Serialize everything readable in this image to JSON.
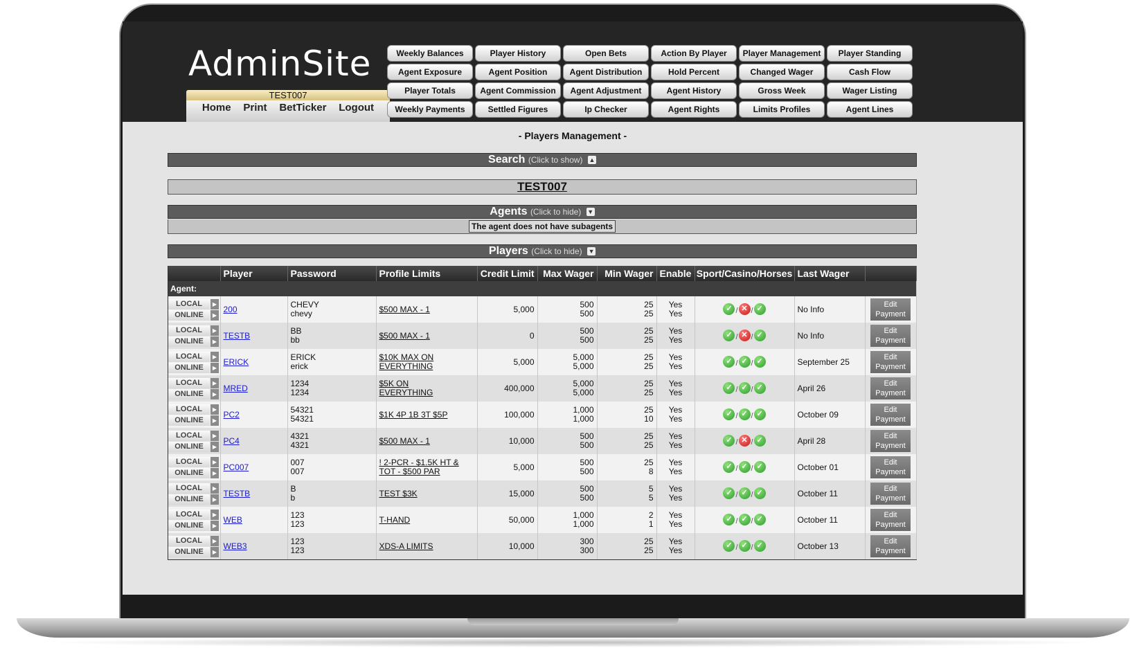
{
  "app": {
    "logo_text": "AdminSite",
    "username": "TEST007",
    "user_links": [
      "Home",
      "Print",
      "BetTicker",
      "Logout"
    ]
  },
  "nav": [
    "Weekly Balances",
    "Player History",
    "Open Bets",
    "Action By Player",
    "Player Management",
    "Player Standing",
    "Agent Exposure",
    "Agent Position",
    "Agent Distribution",
    "Hold Percent",
    "Changed Wager",
    "Cash Flow",
    "Player Totals",
    "Agent Commission",
    "Agent Adjustment",
    "Agent History",
    "Gross Week",
    "Wager Listing",
    "Weekly Payments",
    "Settled Figures",
    "Ip Checker",
    "Agent Rights",
    "Limits Profiles",
    "Agent Lines"
  ],
  "page": {
    "title": "- Players Management -",
    "search": {
      "label": "Search",
      "hint": "(Click to show)",
      "icon": "expand-up-icon"
    },
    "agent_name": "TEST007",
    "agents": {
      "label": "Agents",
      "hint": "(Click to hide)",
      "message": "The agent does not have subagents",
      "icon": "collapse-down-icon"
    },
    "players": {
      "label": "Players",
      "hint": "(Click to hide)",
      "icon": "collapse-down-icon"
    }
  },
  "table": {
    "columns": [
      "",
      "Player",
      "Password",
      "Profile Limits",
      "Credit Limit",
      "Max Wager",
      "Min Wager",
      "Enable",
      "Sport/Casino/Horses",
      "Last Wager",
      ""
    ],
    "agent_label": "Agent:",
    "local_label": "LOCAL",
    "online_label": "ONLINE",
    "edit_label": "Edit",
    "payment_label": "Payment",
    "rows": [
      {
        "player": "200",
        "pw1": "CHEVY",
        "pw2": "chevy",
        "profile1": "$500 MAX - 1",
        "profile2": "",
        "credit": "5,000",
        "max1": "500",
        "max2": "500",
        "min1": "25",
        "min2": "25",
        "en1": "Yes",
        "en2": "Yes",
        "status": [
          "ok",
          "no",
          "ok"
        ],
        "last": "No Info"
      },
      {
        "player": "TESTB",
        "pw1": "BB",
        "pw2": "bb",
        "profile1": "$500 MAX - 1",
        "profile2": "",
        "credit": "0",
        "max1": "500",
        "max2": "500",
        "min1": "25",
        "min2": "25",
        "en1": "Yes",
        "en2": "Yes",
        "status": [
          "ok",
          "no",
          "ok"
        ],
        "last": "No Info"
      },
      {
        "player": "ERICK",
        "pw1": "ERICK",
        "pw2": "erick",
        "profile1": "$10K MAX ON",
        "profile2": "EVERYTHING",
        "credit": "5,000",
        "max1": "5,000",
        "max2": "5,000",
        "min1": "25",
        "min2": "25",
        "en1": "Yes",
        "en2": "Yes",
        "status": [
          "ok",
          "ok",
          "ok"
        ],
        "last": "September 25"
      },
      {
        "player": "MRED",
        "pw1": "1234",
        "pw2": "1234",
        "profile1": "$5K ON",
        "profile2": "EVERYTHING",
        "credit": "400,000",
        "max1": "5,000",
        "max2": "5,000",
        "min1": "25",
        "min2": "25",
        "en1": "Yes",
        "en2": "Yes",
        "status": [
          "ok",
          "ok",
          "ok"
        ],
        "last": "April 26"
      },
      {
        "player": "PC2",
        "pw1": "54321",
        "pw2": "54321",
        "profile1": "$1K 4P 1B 3T $5P",
        "profile2": "",
        "credit": "100,000",
        "max1": "1,000",
        "max2": "1,000",
        "min1": "25",
        "min2": "10",
        "en1": "Yes",
        "en2": "Yes",
        "status": [
          "ok",
          "ok",
          "ok"
        ],
        "last": "October 09"
      },
      {
        "player": "PC4",
        "pw1": "4321",
        "pw2": "4321",
        "profile1": "$500 MAX - 1",
        "profile2": "",
        "credit": "10,000",
        "max1": "500",
        "max2": "500",
        "min1": "25",
        "min2": "25",
        "en1": "Yes",
        "en2": "Yes",
        "status": [
          "ok",
          "no",
          "ok"
        ],
        "last": "April 28"
      },
      {
        "player": "PC007",
        "pw1": "007",
        "pw2": "007",
        "profile1": "! 2-PCR - $1.5K HT &",
        "profile2": "TOT - $500 PAR",
        "credit": "5,000",
        "max1": "500",
        "max2": "500",
        "min1": "25",
        "min2": "8",
        "en1": "Yes",
        "en2": "Yes",
        "status": [
          "ok",
          "ok",
          "ok"
        ],
        "last": "October 01"
      },
      {
        "player": "TESTB",
        "pw1": "B",
        "pw2": "b",
        "profile1": "TEST $3K",
        "profile2": "",
        "credit": "15,000",
        "max1": "500",
        "max2": "500",
        "min1": "5",
        "min2": "5",
        "en1": "Yes",
        "en2": "Yes",
        "status": [
          "ok",
          "ok",
          "ok"
        ],
        "last": "October 11"
      },
      {
        "player": "WEB",
        "pw1": "123",
        "pw2": "123",
        "profile1": "T-HAND",
        "profile2": "",
        "credit": "50,000",
        "max1": "1,000",
        "max2": "1,000",
        "min1": "2",
        "min2": "1",
        "en1": "Yes",
        "en2": "Yes",
        "status": [
          "ok",
          "ok",
          "ok"
        ],
        "last": "October 11"
      },
      {
        "player": "WEB3",
        "pw1": "123",
        "pw2": "123",
        "profile1": "XDS-A LIMITS",
        "profile2": "",
        "credit": "10,000",
        "max1": "300",
        "max2": "300",
        "min1": "25",
        "min2": "25",
        "en1": "Yes",
        "en2": "Yes",
        "status": [
          "ok",
          "ok",
          "ok"
        ],
        "last": "October 13"
      }
    ]
  }
}
